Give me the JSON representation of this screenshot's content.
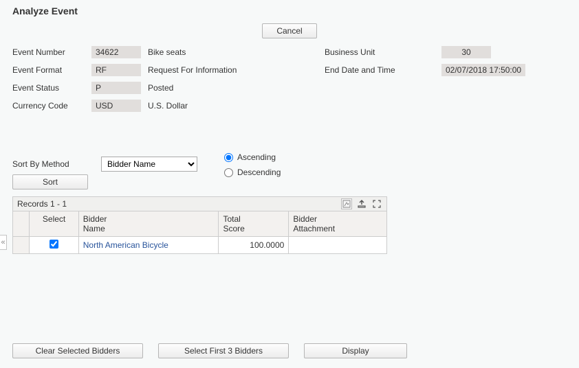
{
  "title": "Analyze Event",
  "top_button": {
    "cancel": "Cancel"
  },
  "fields": {
    "event_number": {
      "label": "Event Number",
      "value": "34622",
      "text": "Bike seats"
    },
    "event_format": {
      "label": "Event Format",
      "value": "RF",
      "text": "Request For Information"
    },
    "event_status": {
      "label": "Event Status",
      "value": "P",
      "text": "Posted"
    },
    "currency_code": {
      "label": "Currency Code",
      "value": "USD",
      "text": "U.S. Dollar"
    },
    "business_unit": {
      "label": "Business Unit",
      "value": "30"
    },
    "end_datetime": {
      "label": "End Date and Time",
      "value": "02/07/2018 17:50:00"
    }
  },
  "sort": {
    "label": "Sort By Method",
    "selected": "Bidder Name",
    "ascending": "Ascending",
    "descending": "Descending",
    "sort_button": "Sort"
  },
  "records": {
    "summary": "Records 1 - 1"
  },
  "table": {
    "headers": {
      "select": "Select",
      "bidder_name": "Bidder\nName",
      "total_score": "Total\nScore",
      "bidder_attachment": "Bidder\nAttachment"
    },
    "rows": [
      {
        "selected": true,
        "bidder_name": "North American Bicycle",
        "total_score": "100.0000",
        "attachment": ""
      }
    ]
  },
  "bottom": {
    "clear": "Clear Selected Bidders",
    "select3": "Select First 3 Bidders",
    "display": "Display"
  }
}
